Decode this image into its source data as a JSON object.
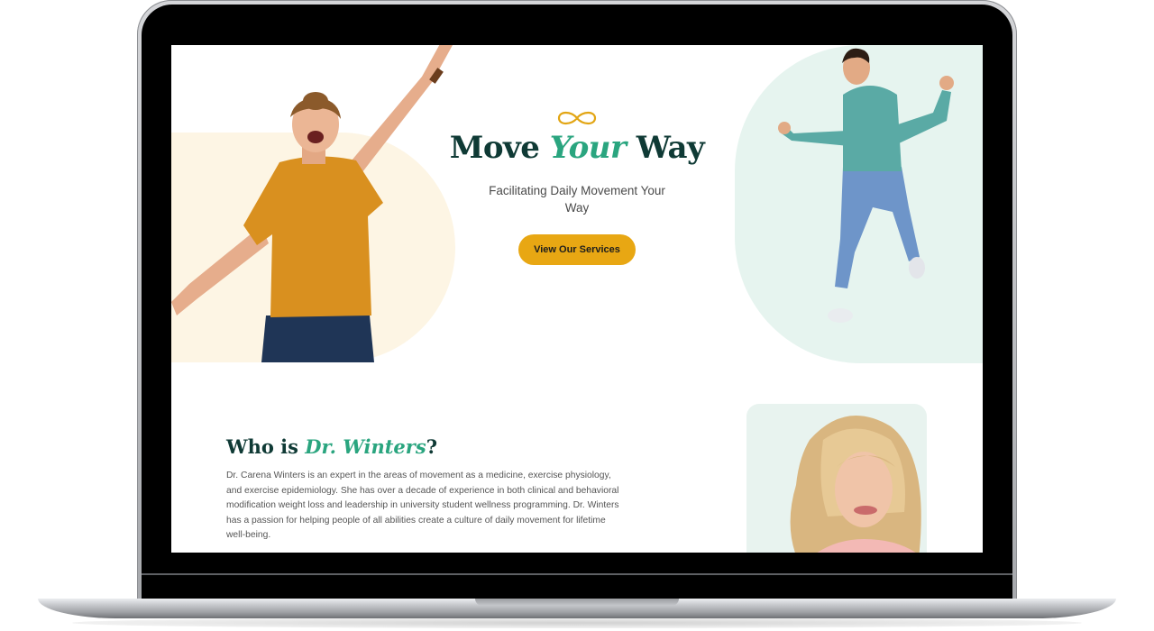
{
  "hero": {
    "title_part1": "Move",
    "title_accent": "Your",
    "title_part2": "Way",
    "subtitle": "Facilitating Daily Movement Your Way",
    "cta_label": "View Our Services"
  },
  "about": {
    "title_part1": "Who is",
    "title_accent": "Dr. Winters",
    "title_part2": "?",
    "body": "Dr. Carena Winters is an expert in the areas of movement as a medicine, exercise physiology, and exercise epidemiology. She has over a decade of experience in both clinical and behavioral modification weight loss and leadership in university student wellness programming. Dr. Winters has a passion for helping people of all abilities create a culture of daily movement for lifetime well-being."
  },
  "colors": {
    "primary_dark": "#0f3a35",
    "accent_green": "#2aa57f",
    "button_gold": "#e8a713",
    "blob_cream": "#fdf5e4",
    "blob_mint": "#e6f4ef"
  },
  "icons": {
    "logo": "infinity-icon"
  }
}
